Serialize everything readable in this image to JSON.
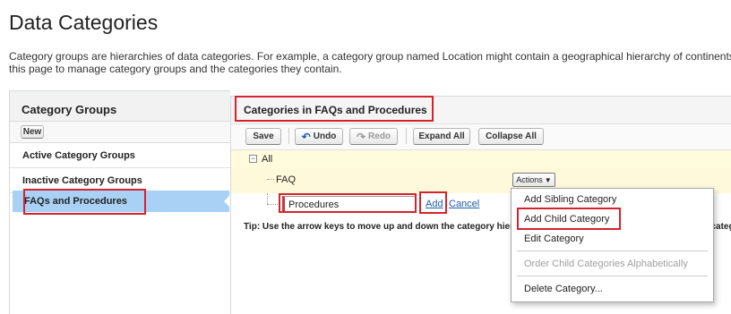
{
  "page": {
    "title": "Data Categories",
    "description_line1": "Category groups are hierarchies of data categories. For example, a category group named Location might contain a geographical hierarchy of continents, countries, and cities. Use",
    "description_line2": "this page to manage category groups and the categories they contain."
  },
  "left_panel": {
    "heading": "Category Groups",
    "new_label": "New",
    "active_label": "Active Category Groups",
    "inactive_label": "Inactive Category Groups",
    "selected_group": "FAQs and Procedures"
  },
  "right_panel": {
    "heading": "Categories in FAQs and Procedures",
    "toolbar": {
      "save": "Save",
      "undo": "Undo",
      "redo": "Redo",
      "expand_all": "Expand All",
      "collapse_all": "Collapse All"
    },
    "tree": {
      "root": "All",
      "child": "FAQ",
      "new_child_value": "Procedures",
      "add_link": "Add",
      "cancel_link": "Cancel"
    },
    "tip": "Tip: Use the arrow keys to move up and down the category hierarchy. Press the Enter key to edit the selected category. Press the Tab key to move to the Actions menu and",
    "actions_label": "Actions"
  },
  "actions_menu": {
    "items": [
      {
        "label": "Add Sibling Category",
        "enabled": true
      },
      {
        "label": "Add Child Category",
        "enabled": true
      },
      {
        "label": "Edit Category",
        "enabled": true
      },
      {
        "label": "Order Child Categories Alphabetically",
        "enabled": false
      },
      {
        "label": "Delete Category...",
        "enabled": true
      }
    ]
  },
  "icons": {
    "undo": "undo-icon",
    "redo": "redo-icon",
    "tree_toggle": "minus-icon",
    "dropdown": "caret-down-icon"
  },
  "colors": {
    "highlight": "#d5232e",
    "selected_row": "#a8d1f5",
    "tree_row_bg": "#fff9db",
    "link": "#1f5ca8"
  }
}
